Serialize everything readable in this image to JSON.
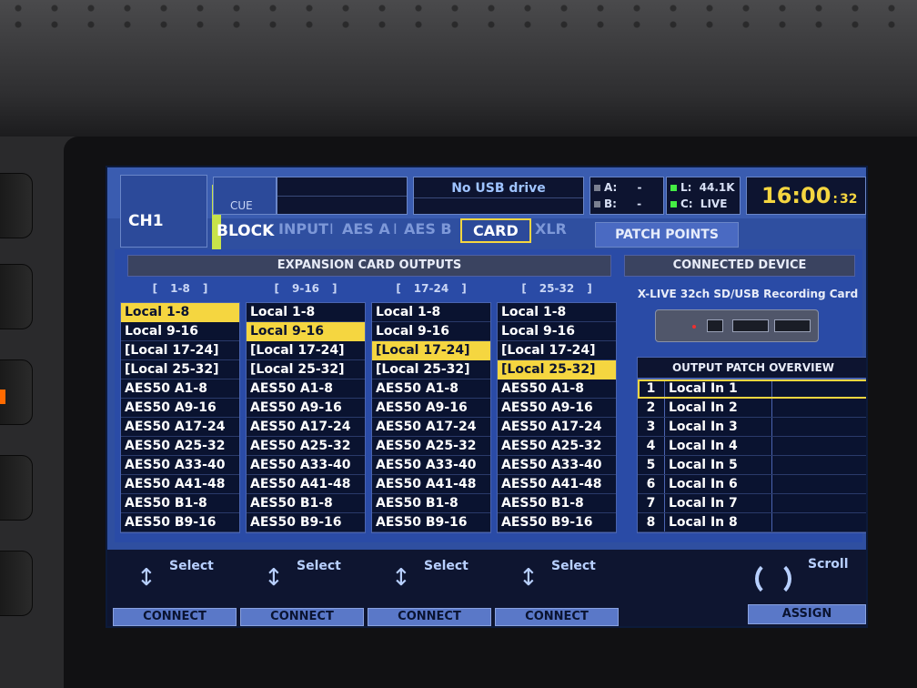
{
  "channel": {
    "label": "CH1",
    "cue_label": "CUE"
  },
  "usb": {
    "status": "No USB drive"
  },
  "inputs_status": {
    "a_label": "A:",
    "a_value": "-",
    "b_label": "B:",
    "b_value": "-",
    "l_label": "L:",
    "l_value": "44.1K",
    "c_label": "C:",
    "c_value": "LIVE"
  },
  "clock": {
    "time": "16:00",
    "seconds": "32"
  },
  "tabs": {
    "block": "BLOCK",
    "input": "INPUT",
    "aes_a": "AES A",
    "aes_b": "AES B",
    "card": "CARD",
    "xlr": "XLR",
    "separator": "I",
    "patch_points": "PATCH POINTS"
  },
  "expansion": {
    "title": "EXPANSION CARD OUTPUTS",
    "columns": [
      {
        "header": "1-8",
        "selected": 0
      },
      {
        "header": "9-16",
        "selected": 1
      },
      {
        "header": "17-24",
        "selected": 2
      },
      {
        "header": "25-32",
        "selected": 3
      }
    ],
    "options": [
      "Local 1-8",
      "Local 9-16",
      "[Local 17-24]",
      "[Local 25-32]",
      "AES50 A1-8",
      "AES50 A9-16",
      "AES50 A17-24",
      "AES50 A25-32",
      "AES50 A33-40",
      "AES50 A41-48",
      "AES50 B1-8",
      "AES50 B9-16"
    ]
  },
  "device": {
    "title": "CONNECTED DEVICE",
    "name": "X-LIVE 32ch SD/USB Recording Card"
  },
  "overview": {
    "title": "OUTPUT PATCH OVERVIEW",
    "rows": [
      {
        "num": "1",
        "src": "Local In 1"
      },
      {
        "num": "2",
        "src": "Local In 2"
      },
      {
        "num": "3",
        "src": "Local In 3"
      },
      {
        "num": "4",
        "src": "Local In 4"
      },
      {
        "num": "5",
        "src": "Local In 5"
      },
      {
        "num": "6",
        "src": "Local In 6"
      },
      {
        "num": "7",
        "src": "Local In 7"
      },
      {
        "num": "8",
        "src": "Local In 8"
      }
    ]
  },
  "controls": {
    "select_label": "Select",
    "connect_label": "CONNECT",
    "scroll_label": "Scroll",
    "assign_label": "ASSIGN"
  },
  "colors": {
    "screen_bg": "#2f4fa0",
    "highlight": "#f5d640",
    "meter_green": "#c8e34a"
  }
}
